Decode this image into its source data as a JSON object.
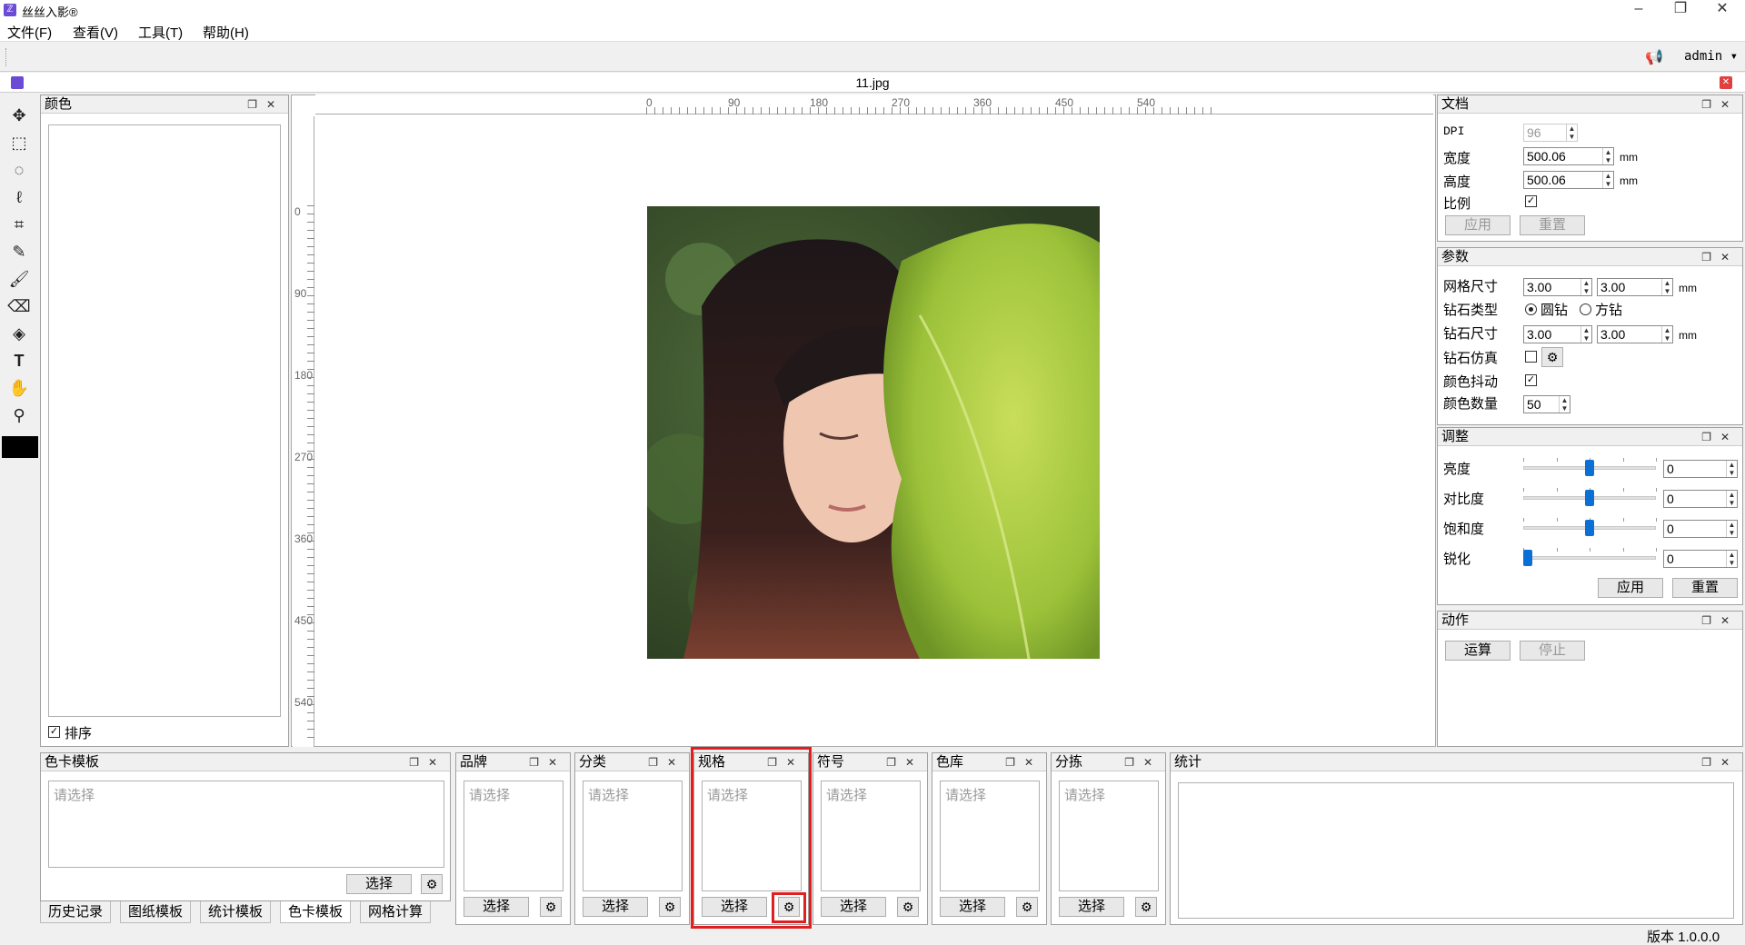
{
  "window": {
    "title": "丝丝入影®",
    "controls": [
      "–",
      "❐",
      "✕"
    ]
  },
  "menu": [
    "文件(F)",
    "查看(V)",
    "工具(T)",
    "帮助(H)"
  ],
  "user": {
    "name": "admin"
  },
  "document": {
    "filename": "11.jpg"
  },
  "colors_panel": {
    "title": "颜色",
    "sort_label": "排序",
    "sort_checked": true
  },
  "ruler": {
    "h_labels": [
      "0",
      "90",
      "180",
      "270",
      "360",
      "450",
      "540"
    ],
    "v_labels": [
      "0",
      "90",
      "180",
      "270",
      "360",
      "450",
      "540"
    ]
  },
  "doc_panel": {
    "title": "文档",
    "dpi_label": "DPI",
    "dpi_value": "96",
    "width_label": "宽度",
    "width_value": "500.06",
    "width_unit": "mm",
    "height_label": "高度",
    "height_value": "500.06",
    "height_unit": "mm",
    "ratio_label": "比例",
    "apply": "应用",
    "reset": "重置"
  },
  "params_panel": {
    "title": "参数",
    "grid_label": "网格尺寸",
    "grid_w": "3.00",
    "grid_h": "3.00",
    "grid_unit": "mm",
    "diamond_type_label": "钻石类型",
    "round": "圆钻",
    "square": "方钻",
    "diamond_size_label": "钻石尺寸",
    "size_w": "3.00",
    "size_h": "3.00",
    "size_unit": "mm",
    "sim_label": "钻石仿真",
    "dither_label": "颜色抖动",
    "count_label": "颜色数量",
    "count_value": "50"
  },
  "adjust_panel": {
    "title": "调整",
    "rows": [
      {
        "label": "亮度",
        "value": "0",
        "level": 0.5
      },
      {
        "label": "对比度",
        "value": "0",
        "level": 0.5
      },
      {
        "label": "饱和度",
        "value": "0",
        "level": 0.5
      },
      {
        "label": "锐化",
        "value": "0",
        "level": 0.0
      }
    ],
    "apply": "应用",
    "reset": "重置"
  },
  "action_panel": {
    "title": "动作",
    "run": "运算",
    "stop": "停止"
  },
  "bottom": {
    "cardtpl": {
      "title": "色卡模板",
      "placeholder": "请选择",
      "select": "选择"
    },
    "brand": {
      "title": "品牌",
      "placeholder": "请选择",
      "select": "选择"
    },
    "category": {
      "title": "分类",
      "placeholder": "请选择",
      "select": "选择"
    },
    "spec": {
      "title": "规格",
      "placeholder": "请选择",
      "select": "选择"
    },
    "symbol": {
      "title": "符号",
      "placeholder": "请选择",
      "select": "选择"
    },
    "library": {
      "title": "色库",
      "placeholder": "请选择",
      "select": "选择"
    },
    "sort": {
      "title": "分拣",
      "placeholder": "请选择",
      "select": "选择"
    },
    "stats": {
      "title": "统计"
    }
  },
  "tabs": [
    "历史记录",
    "图纸模板",
    "统计模板",
    "色卡模板",
    "网格计算"
  ],
  "status": {
    "version": "版本 1.0.0.0"
  },
  "colors": {
    "accent": "#0b6fd6",
    "highlight": "#e02020",
    "swatch": "#000000"
  }
}
